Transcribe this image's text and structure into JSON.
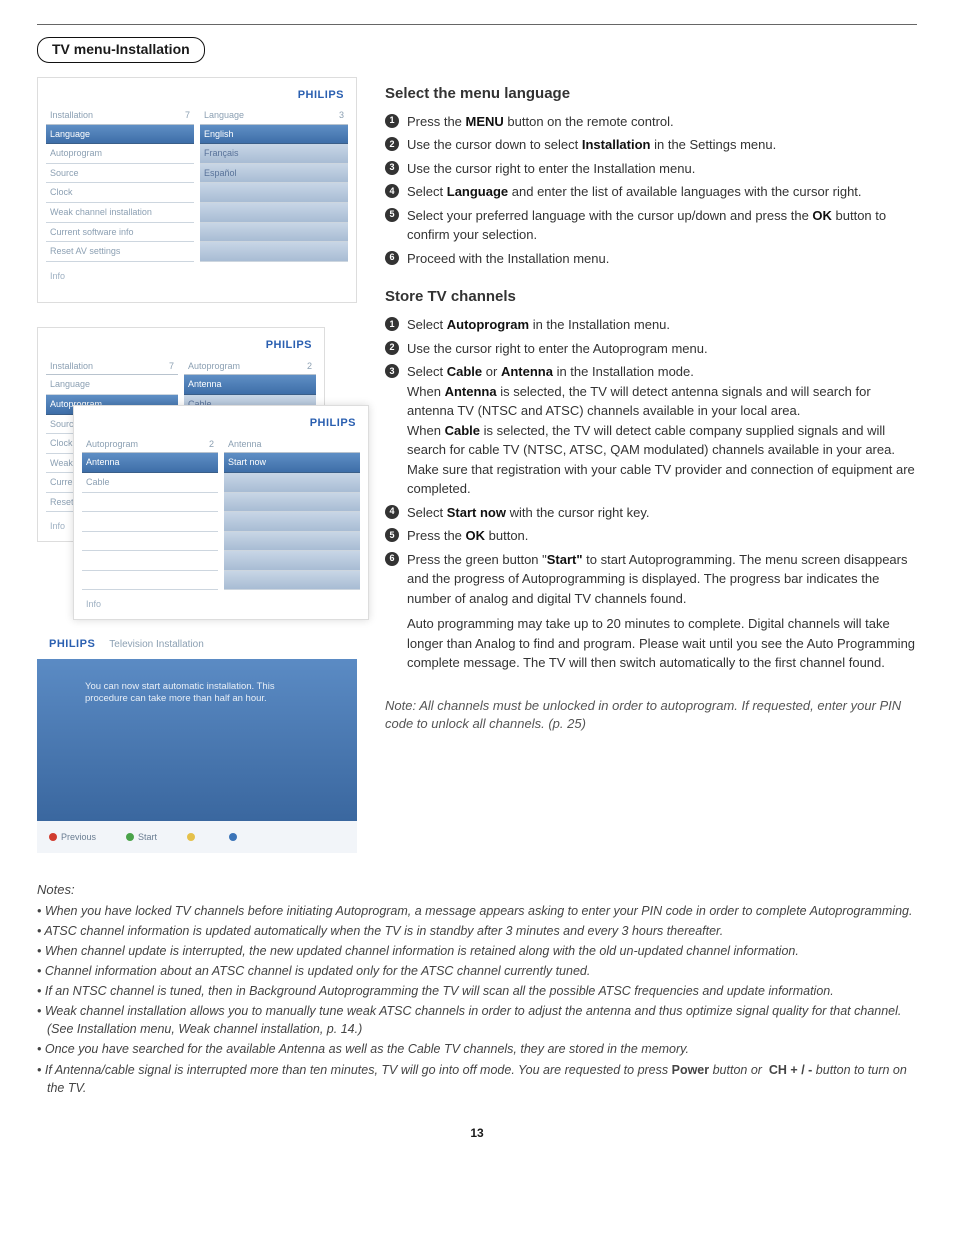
{
  "header": {
    "title": "TV menu-Installation"
  },
  "brand": "PHILIPS",
  "osd1": {
    "left": {
      "title": "Installation",
      "count": "7",
      "rows": [
        "Language",
        "Autoprogram",
        "Source",
        "Clock",
        "Weak channel installation",
        "Current software info",
        "Reset AV settings"
      ]
    },
    "right": {
      "title": "Language",
      "count": "3",
      "rows": [
        "English",
        "Français",
        "Español"
      ]
    },
    "info": "Info"
  },
  "osd2a": {
    "left": {
      "title": "Installation",
      "count": "7",
      "rows": [
        "Language",
        "Autoprogram",
        "Source",
        "Clock",
        "Weak",
        "Curren",
        "Reset"
      ]
    },
    "right": {
      "title": "Autoprogram",
      "count": "2",
      "rows": [
        "Antenna",
        "Cable"
      ]
    },
    "info": "Info"
  },
  "osd2b": {
    "left": {
      "title": "Autoprogram",
      "count": "2",
      "rows": [
        "Antenna",
        "Cable"
      ]
    },
    "right": {
      "title": "Antenna",
      "rows": [
        "Start now"
      ]
    },
    "info": "Info"
  },
  "install": {
    "title": "Television Installation",
    "body1": "You can now start automatic installation. This",
    "body2": "procedure can take more than half an hour.",
    "foot": {
      "prev": "Previous",
      "start": "Start"
    }
  },
  "section1": {
    "heading": "Select the menu language",
    "steps": [
      "Press the <b>MENU</b> button on the remote control.",
      "Use the cursor down to select <b>Installation</b> in the Settings menu.",
      "Use the cursor right to enter the Installation menu.",
      "Select <b>Language</b> and enter the list of available languages with the cursor right.",
      "Select your preferred language with the cursor up/down and press the <b>OK</b> button to confirm your selection.",
      "Proceed with the Installation menu."
    ]
  },
  "section2": {
    "heading": "Store TV channels",
    "steps": [
      "Select <b>Autoprogram</b> in the Installation menu.",
      "Use the cursor right to enter the Autoprogram menu.",
      "Select <b>Cable</b> or <b>Antenna</b> in the Installation mode.<br>When <b>Antenna</b> is selected, the TV will detect antenna signals and will search for antenna TV (NTSC and ATSC) channels available in your local area.<br>When <b>Cable</b> is selected, the TV will detect cable company supplied signals and will search for cable TV (NTSC, ATSC, QAM modulated) channels available in your area.<br>Make sure that registration with your cable TV provider and connection of equipment are completed.",
      "Select <b>Start now</b> with the cursor right key.",
      "Press the <b>OK</b> button.",
      "Press the green button \"<b>Start\"</b> to start Autoprogramming. The menu screen disappears and the progress of Autoprogramming is displayed. The progress bar indicates the number of analog and digital TV channels found.<p>Auto programming may take up to 20 minutes to complete. Digital channels will take longer than Analog to find and program. Please wait until you see the Auto Programming complete message. The TV will then switch automatically to the first channel found.</p>"
    ],
    "note": "Note: All channels must be unlocked in order to autoprogram. If requested, enter your PIN code to unlock all channels. (p. 25)"
  },
  "bottom": {
    "heading": "Notes:",
    "items": [
      "When you have locked TV channels before initiating Autoprogram, a message appears asking to enter your PIN code in order to complete Autoprogramming.",
      "ATSC channel information is updated automatically when the TV is in standby after 3 minutes and every 3 hours thereafter.",
      "When channel update is interrupted, the new updated channel information is retained along with the old un-updated channel information.",
      "Channel information about an ATSC channel is updated only for the ATSC channel currently tuned.",
      "If an NTSC channel is tuned, then in Background Autoprogramming the TV will scan all the possible ATSC frequencies and update information.",
      "Weak channel installation allows you to manually tune weak ATSC channels in order to adjust the antenna and thus optimize signal quality for that channel. (See Installation menu, Weak channel installation, p. 14.)",
      "Once you have searched for the available Antenna as well as the Cable TV channels, they are stored in the memory.",
      "If Antenna/cable signal is interrupted more than ten minutes, TV will go into off mode. You are requested to press <b style='font-style:normal'>Power</b> button or &nbsp;<b style='font-style:normal'>CH + / -</b> button to turn on the TV."
    ]
  },
  "pageNumber": "13"
}
